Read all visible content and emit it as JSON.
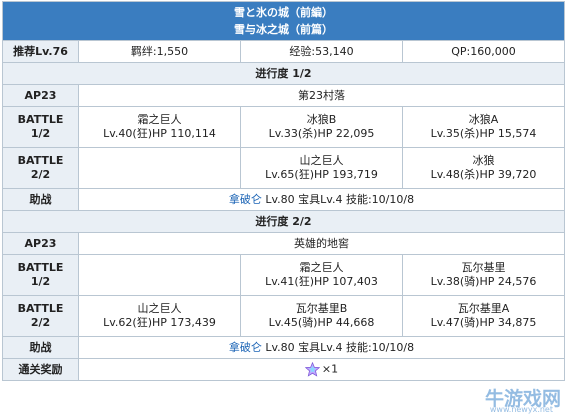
{
  "title_line1": "雪と氷の城（前編）",
  "title_line2": "雪与冰之城（前篇）",
  "info": {
    "recommend": "推荐Lv.76",
    "bond": "羁绊:1,550",
    "exp": "经验:53,140",
    "qp": "QP:160,000"
  },
  "sections": [
    {
      "progress": "进行度 1/2",
      "ap": "AP23",
      "location": "第23村落",
      "battles": [
        {
          "label1": "BATTLE",
          "label2": "1/2",
          "enemies": [
            {
              "name": "霜之巨人",
              "stats": "Lv.40(狂)HP 110,114"
            },
            {
              "name": "冰狼B",
              "stats": "Lv.33(杀)HP 22,095"
            },
            {
              "name": "冰狼A",
              "stats": "Lv.35(杀)HP 15,574"
            }
          ]
        },
        {
          "label1": "BATTLE",
          "label2": "2/2",
          "enemies": [
            {
              "name": "",
              "stats": ""
            },
            {
              "name": "山之巨人",
              "stats": "Lv.65(狂)HP 193,719"
            },
            {
              "name": "冰狼",
              "stats": "Lv.48(杀)HP 39,720"
            }
          ]
        }
      ],
      "support_label": "助战",
      "support_name": "拿破仑",
      "support_detail": " Lv.80 宝具Lv.4 技能:10/10/8"
    },
    {
      "progress": "进行度 2/2",
      "ap": "AP23",
      "location": "英雄的地窖",
      "battles": [
        {
          "label1": "BATTLE",
          "label2": "1/2",
          "enemies": [
            {
              "name": "",
              "stats": ""
            },
            {
              "name": "霜之巨人",
              "stats": "Lv.41(狂)HP 107,403"
            },
            {
              "name": "瓦尔基里",
              "stats": "Lv.38(骑)HP 24,576"
            }
          ]
        },
        {
          "label1": "BATTLE",
          "label2": "2/2",
          "enemies": [
            {
              "name": "山之巨人",
              "stats": "Lv.62(狂)HP 173,439"
            },
            {
              "name": "瓦尔基里B",
              "stats": "Lv.45(骑)HP 44,668"
            },
            {
              "name": "瓦尔基里A",
              "stats": "Lv.47(骑)HP 34,875"
            }
          ]
        }
      ],
      "support_label": "助战",
      "support_name": "拿破仑",
      "support_detail": " Lv.80 宝具Lv.4 技能:10/10/8"
    }
  ],
  "reward": {
    "label": "通关奖励",
    "icon": "star-quartz-icon",
    "count": "×1"
  },
  "watermark": {
    "main": "牛游戏网",
    "url": "www.newyx.net"
  }
}
